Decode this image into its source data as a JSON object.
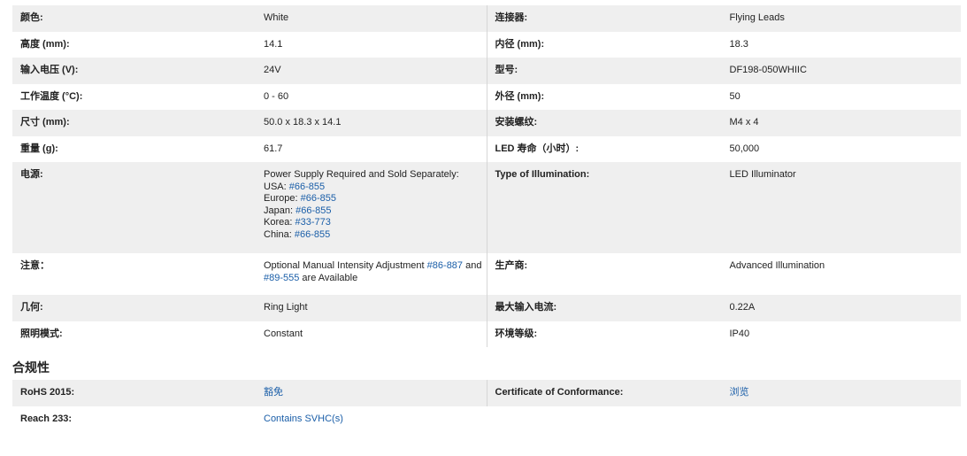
{
  "specs": [
    {
      "l_label": "颜色:",
      "l_value": "White",
      "r_label": "连接器:",
      "r_value": "Flying Leads"
    },
    {
      "l_label": "高度 (mm):",
      "l_value": "14.1",
      "r_label": "内径 (mm):",
      "r_value": "18.3"
    },
    {
      "l_label": "输入电压 (V):",
      "l_value": "24V",
      "r_label": "型号:",
      "r_value": "DF198-050WHIIC"
    },
    {
      "l_label": "工作温度 (°C):",
      "l_value": "0 - 60",
      "r_label": "外径 (mm):",
      "r_value": "50"
    },
    {
      "l_label": "尺寸 (mm):",
      "l_value": "50.0 x 18.3 x 14.1",
      "r_label": "安装螺纹:",
      "r_value": "M4 x 4"
    },
    {
      "l_label": "重量 (g):",
      "l_value": "61.7",
      "r_label": "LED 寿命（小时）:",
      "r_value": "50,000"
    }
  ],
  "power": {
    "label": "电源:",
    "intro": "Power Supply Required and Sold Separately:",
    "lines": [
      {
        "prefix": "USA: ",
        "link": "#66-855"
      },
      {
        "prefix": "Europe: ",
        "link": "#66-855"
      },
      {
        "prefix": "Japan: ",
        "link": "#66-855"
      },
      {
        "prefix": "Korea: ",
        "link": "#33-773"
      },
      {
        "prefix": "China: ",
        "link": "#66-855"
      }
    ],
    "r_label": "Type of Illumination:",
    "r_value": "LED Illuminator"
  },
  "note": {
    "label": "注意：",
    "text1": "Optional Manual Intensity Adjustment ",
    "link1": "#86-887",
    "text2": " and",
    "link2": "#89-555",
    "text3": " are Available",
    "r_label": "生产商:",
    "r_value": "Advanced Illumination"
  },
  "specs2": [
    {
      "l_label": "几何:",
      "l_value": "Ring Light",
      "r_label": "最大输入电流:",
      "r_value": "0.22A"
    },
    {
      "l_label": "照明模式:",
      "l_value": "Constant",
      "r_label": "环境等级:",
      "r_value": "IP40"
    }
  ],
  "compliance": {
    "title": "合规性",
    "rohs_label": "RoHS 2015:",
    "rohs_value": "豁免",
    "coc_label": "Certificate of Conformance:",
    "coc_value": "浏览",
    "reach_label": "Reach 233:",
    "reach_value": "Contains SVHC(s)"
  },
  "colors": {
    "link": "#1a5ea8",
    "shade": "#efefef"
  }
}
